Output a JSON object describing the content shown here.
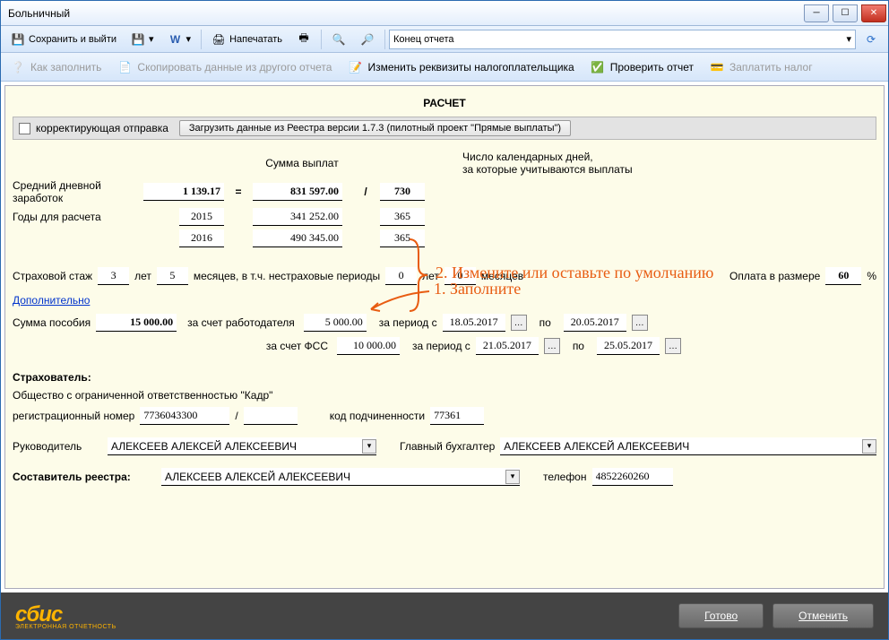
{
  "window_title": "Больничный",
  "toolbar": {
    "save_exit": "Сохранить и выйти",
    "print": "Напечатать",
    "combo_value": "Конец отчета"
  },
  "toolbar2": {
    "how_fill": "Как заполнить",
    "copy_data": "Скопировать данные из другого отчета",
    "edit_req": "Изменить реквизиты налогоплательщика",
    "check": "Проверить отчет",
    "pay_tax": "Заплатить налог"
  },
  "panel_title": "РАСЧЕТ",
  "corr_send": "корректирующая отправка",
  "load_btn": "Загрузить данные из Реестра версии 1.7.3 (пилотный проект \"Прямые выплаты\")",
  "headers": {
    "sum_pay": "Сумма выплат",
    "calendar_days": "Число календарных дней,\nза которые учитываются выплаты"
  },
  "avg_daily_label": "Средний дневной\nзаработок",
  "avg_daily_value": "1 139.17",
  "total_sum": "831 597.00",
  "total_days": "730",
  "years_label": "Годы для расчета",
  "year1": "2015",
  "sum1": "341 252.00",
  "days1": "365",
  "year2": "2016",
  "sum2": "490 345.00",
  "days2": "365",
  "stazh_label": "Страховой стаж",
  "stazh_years": "3",
  "let": "лет",
  "stazh_months": "5",
  "mesyatsev": "месяцев, в т.ч. нестраховые периоды",
  "nonins_years": "0",
  "nonins_months": "0",
  "mes": "месяцев",
  "pay_size_label": "Оплата в размере",
  "pay_percent": "60",
  "additional": "Дополнительно",
  "sum_benefit_label": "Сумма пособия",
  "sum_benefit": "15 000.00",
  "employer_label": "за счет работодателя",
  "employer_sum": "5 000.00",
  "period_from": "за период с",
  "to": "по",
  "emp_date_from": "18.05.2017",
  "emp_date_to": "20.05.2017",
  "fss_label": "за счет ФСС",
  "fss_sum": "10 000.00",
  "fss_date_from": "21.05.2017",
  "fss_date_to": "25.05.2017",
  "insurer_label": "Страхователь:",
  "org_name": "Общество с ограниченной ответственностью \"Кадр\"",
  "reg_num_label": "регистрационный номер",
  "reg_num": "7736043300",
  "slash": "/",
  "sub_code_label": "код подчиненности",
  "sub_code": "77361",
  "director_label": "Руководитель",
  "director": "АЛЕКСЕЕВ АЛЕКСЕЙ АЛЕКСЕЕВИЧ",
  "accountant_label": "Главный бухгалтер",
  "accountant": "АЛЕКСЕЕВ АЛЕКСЕЙ АЛЕКСЕЕВИЧ",
  "compiler_label": "Составитель реестра:",
  "compiler": "АЛЕКСЕЕВ АЛЕКСЕЙ АЛЕКСЕЕВИЧ",
  "phone_label": "телефон",
  "phone": "4852260260",
  "annotation1": "1. Заполните",
  "annotation2": "2. Измените или оставьте по умолчанию",
  "footer": {
    "ready": "Готово",
    "cancel": "Отменить",
    "logo": "сбис",
    "logo_sub": "ЭЛЕКТРОННАЯ ОТЧЕТНОСТЬ"
  }
}
